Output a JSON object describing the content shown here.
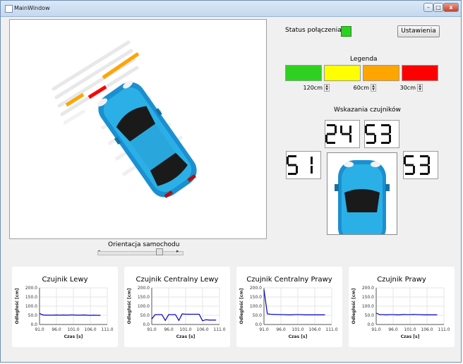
{
  "window": {
    "title": "MainWindow",
    "min_symbol": "–",
    "max_symbol": "□",
    "close_symbol": "x"
  },
  "status": {
    "label": "Status połączenia",
    "color": "#2ed121"
  },
  "settings_button": "Ustawienia",
  "legend": {
    "title": "Legenda",
    "colors": [
      "#2ed121",
      "#ffff00",
      "#ffa500",
      "#ff0000"
    ],
    "thresholds": [
      {
        "value": "120cm"
      },
      {
        "value": "60cm"
      },
      {
        "value": "30cm"
      }
    ]
  },
  "sensors": {
    "title": "Wskazania czujników",
    "front_left": "24",
    "front_right": "53",
    "left": "51",
    "right": "53"
  },
  "orientation": {
    "label": "Orientacja samochodu",
    "value": 0.75
  },
  "spinner_icon": "updown-arrows-icon",
  "chart_data": [
    {
      "type": "line",
      "title": "Czujnik Lewy",
      "xlabel": "Czas [s]",
      "ylabel": "Odległość [cm]",
      "xlim": [
        91.0,
        111.0
      ],
      "ylim": [
        0.0,
        200.0
      ],
      "xticks": [
        "91.0",
        "96.0",
        "101.0",
        "106.0",
        "111.0"
      ],
      "yticks": [
        "0.0",
        "50.0",
        "100.0",
        "150.0",
        "200.0"
      ],
      "series": [
        {
          "color": "#0000cc",
          "x": [
            91.0,
            92,
            93,
            94,
            95,
            96,
            97,
            98,
            99,
            100,
            101,
            102,
            103,
            104,
            105,
            106,
            107,
            108,
            109
          ],
          "y": [
            60,
            52,
            51,
            51,
            51,
            52,
            51,
            52,
            51,
            52,
            52,
            51,
            51,
            52,
            51,
            50,
            51,
            50,
            50
          ]
        }
      ]
    },
    {
      "type": "line",
      "title": "Czujnik Centralny Lewy",
      "xlabel": "Czas [s]",
      "ylabel": "Odległość [cm]",
      "xlim": [
        91.0,
        111.0
      ],
      "ylim": [
        0.0,
        200.0
      ],
      "xticks": [
        "91.0",
        "96.0",
        "101.0",
        "106.0",
        "111.0"
      ],
      "yticks": [
        "0.0",
        "50.0",
        "100.0",
        "150.0",
        "200.0"
      ],
      "series": [
        {
          "color": "#0000cc",
          "x": [
            91.0,
            92,
            93,
            94,
            95,
            96,
            97,
            98,
            99,
            100,
            101,
            102,
            103,
            104,
            105,
            106,
            107,
            108,
            109,
            110
          ],
          "y": [
            30,
            54,
            54,
            54,
            22,
            54,
            54,
            54,
            22,
            58,
            56,
            56,
            56,
            56,
            56,
            20,
            26,
            24,
            24,
            24
          ]
        }
      ]
    },
    {
      "type": "line",
      "title": "Czujnik Centralny Prawy",
      "xlabel": "Czas [s]",
      "ylabel": "Odległość [cm]",
      "xlim": [
        91.0,
        111.0
      ],
      "ylim": [
        0.0,
        200.0
      ],
      "xticks": [
        "91.0",
        "96.0",
        "101.0",
        "106.0",
        "111.0"
      ],
      "yticks": [
        "0.0",
        "50.0",
        "100.0",
        "150.0",
        "200.0"
      ],
      "series": [
        {
          "color": "#0000cc",
          "x": [
            91.0,
            92,
            93,
            94,
            95,
            96,
            97,
            98,
            99,
            100,
            101,
            102,
            103,
            104,
            105,
            106,
            107,
            108,
            109
          ],
          "y": [
            190,
            58,
            56,
            55,
            55,
            54,
            54,
            53,
            53,
            54,
            54,
            54,
            53,
            53,
            53,
            53,
            53,
            53,
            53
          ]
        }
      ]
    },
    {
      "type": "line",
      "title": "Czujnik Prawy",
      "xlabel": "Czas [s]",
      "ylabel": "Odległość [cm]",
      "xlim": [
        91.0,
        111.0
      ],
      "ylim": [
        0.0,
        200.0
      ],
      "xticks": [
        "91.0",
        "96.0",
        "101.0",
        "106.0",
        "111.0"
      ],
      "yticks": [
        "0.0",
        "50.0",
        "100.0",
        "150.0",
        "200.0"
      ],
      "series": [
        {
          "color": "#0000cc",
          "x": [
            91.0,
            92,
            93,
            94,
            95,
            96,
            97,
            98,
            99,
            100,
            101,
            102,
            103,
            104,
            105,
            106,
            107,
            108,
            109
          ],
          "y": [
            62,
            54,
            54,
            53,
            54,
            54,
            53,
            53,
            55,
            54,
            54,
            55,
            54,
            54,
            53,
            53,
            53,
            53,
            53
          ]
        }
      ]
    }
  ]
}
